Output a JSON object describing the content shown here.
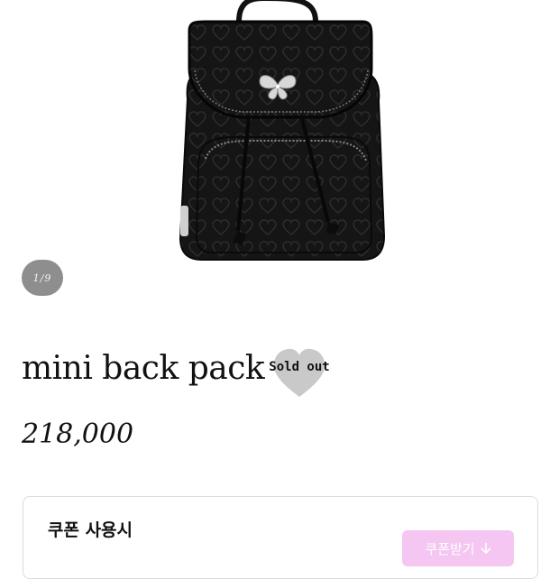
{
  "gallery": {
    "counter": "1/9",
    "image_alt": "black quilted heart mini backpack"
  },
  "product": {
    "title": "mini back pack",
    "badge": "Sold out",
    "price": "218,000"
  },
  "coupon": {
    "title": "쿠폰 사용시",
    "button_label": "쿠폰받기",
    "button_icon": "arrow-down-icon"
  },
  "colors": {
    "badge_heart": "#c9c9c9",
    "coupon_button": "#f4c6f1",
    "counter_bg": "#8e8e8e"
  }
}
